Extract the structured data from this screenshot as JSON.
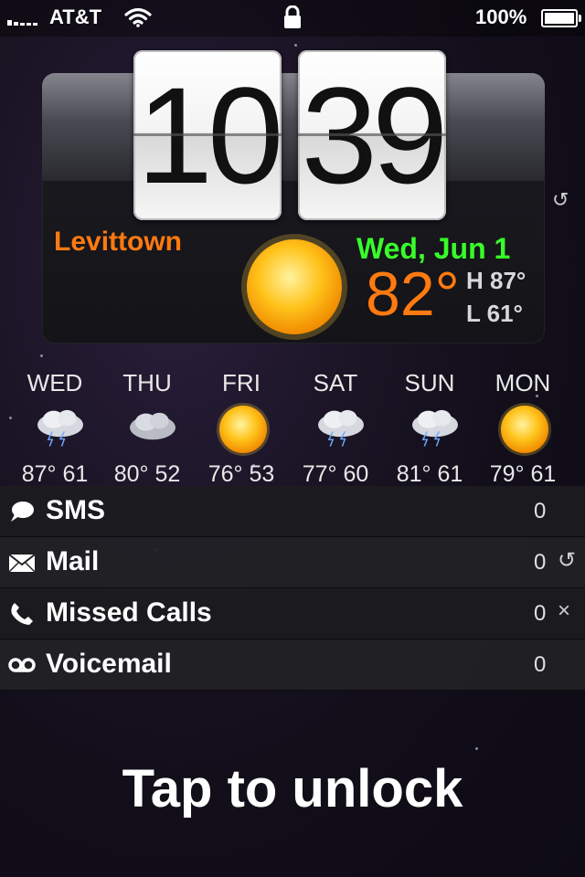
{
  "statusbar": {
    "carrier": "AT&T",
    "battery_percent": "100%",
    "battery_level": 1.0
  },
  "clock": {
    "hours": "10",
    "minutes": "39"
  },
  "weather": {
    "city": "Levittown",
    "date": "Wed, Jun 1",
    "temperature": "82°",
    "high": "H 87°",
    "low": "L 61°",
    "condition_icon": "sun-icon"
  },
  "forecast": [
    {
      "day": "WED",
      "temps": "87° 61",
      "icon": "thunderstorm-icon"
    },
    {
      "day": "THU",
      "temps": "80° 52",
      "icon": "cloudy-icon"
    },
    {
      "day": "FRI",
      "temps": "76° 53",
      "icon": "sun-icon"
    },
    {
      "day": "SAT",
      "temps": "77° 60",
      "icon": "thunderstorm-icon"
    },
    {
      "day": "SUN",
      "temps": "81° 61",
      "icon": "thunderstorm-icon"
    },
    {
      "day": "MON",
      "temps": "79° 61",
      "icon": "sun-icon"
    }
  ],
  "notifications": [
    {
      "label": "SMS",
      "count": "0",
      "icon": "speech-bubble-icon"
    },
    {
      "label": "Mail",
      "count": "0",
      "icon": "envelope-icon",
      "side": "↺"
    },
    {
      "label": "Missed Calls",
      "count": "0",
      "icon": "phone-icon",
      "side": "×"
    },
    {
      "label": "Voicemail",
      "count": "0",
      "icon": "voicemail-icon"
    }
  ],
  "unlock_text": "Tap to unlock",
  "colors": {
    "accent_orange": "#ff7a10",
    "date_green": "#38ff2a"
  }
}
